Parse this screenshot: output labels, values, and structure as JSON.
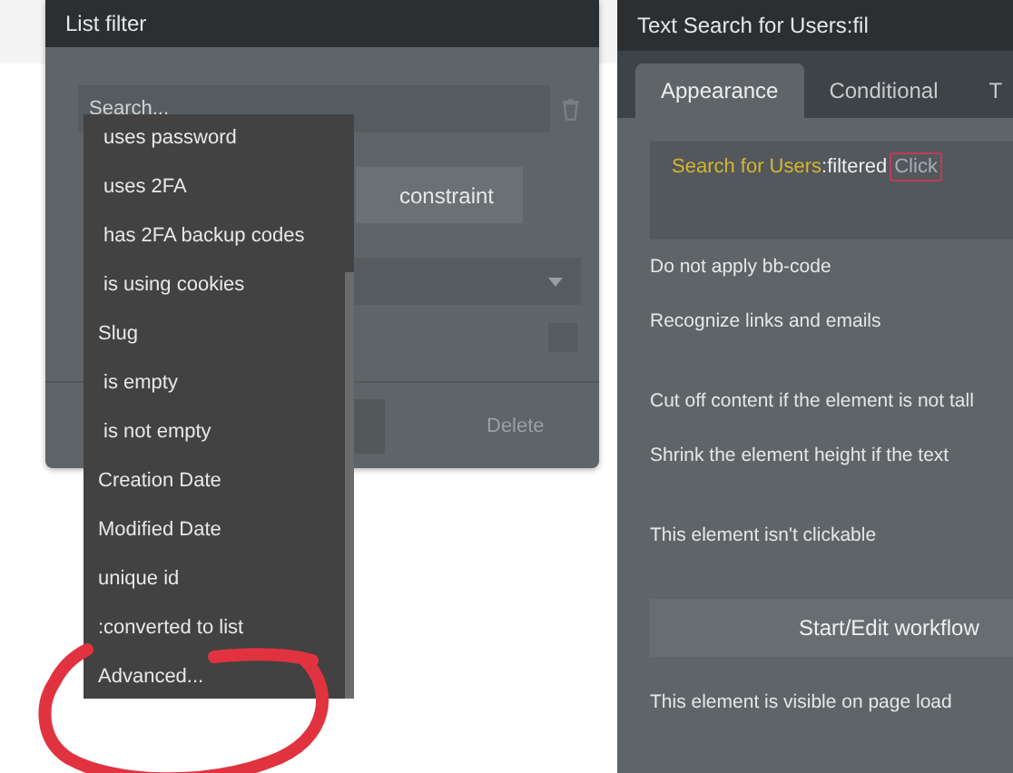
{
  "list_filter": {
    "title": "List filter",
    "search": {
      "placeholder": "Search..."
    },
    "constraint_button": "constraint",
    "checkbox": {
      "checked": false
    },
    "delete_button": {
      "label": "Delete",
      "disabled": true
    },
    "dropdown": {
      "items": [
        {
          "label": "uses password",
          "indent": true
        },
        {
          "label": "uses 2FA",
          "indent": true
        },
        {
          "label": "has 2FA backup codes",
          "indent": true
        },
        {
          "label": "is using cookies",
          "indent": true
        },
        {
          "label": "Slug",
          "indent": false
        },
        {
          "label": "is empty",
          "indent": true
        },
        {
          "label": "is not empty",
          "indent": true
        },
        {
          "label": "Creation Date",
          "indent": false
        },
        {
          "label": "Modified Date",
          "indent": false
        },
        {
          "label": "unique id",
          "indent": false
        },
        {
          "label": ":converted to list",
          "indent": false
        },
        {
          "label": "Advanced...",
          "indent": false
        }
      ]
    }
  },
  "property_editor": {
    "title": "Text Search for Users:fil",
    "tabs": [
      {
        "label": "Appearance",
        "selected": true
      },
      {
        "label": "Conditional",
        "selected": false
      },
      {
        "label": "T",
        "selected": false
      }
    ],
    "expression": {
      "source": "Search for Users",
      "operator": ":filtered",
      "hint": "Click"
    },
    "options": [
      {
        "label": "Do not apply bb-code",
        "kind": "option"
      },
      {
        "label": "Recognize links and emails",
        "kind": "option"
      },
      {
        "label": "Cut off content if the element is not tall",
        "kind": "option"
      },
      {
        "label": "Shrink the element height if the text",
        "kind": "option"
      },
      {
        "label": "This element isn't clickable",
        "kind": "option"
      },
      {
        "label": "Start/Edit workflow",
        "kind": "button"
      },
      {
        "label": "This element is visible on page load",
        "kind": "option"
      }
    ]
  }
}
